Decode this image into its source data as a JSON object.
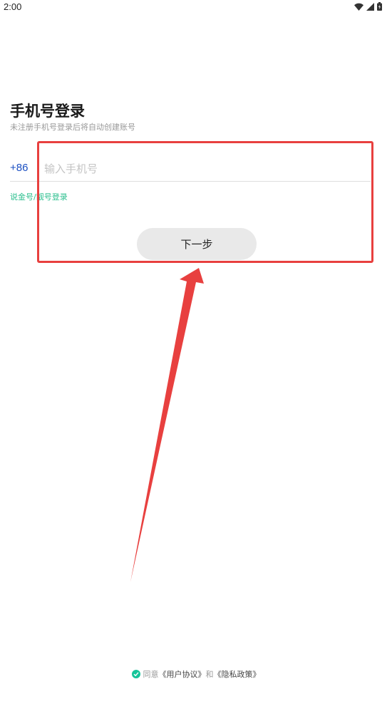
{
  "status_bar": {
    "time": "2:00",
    "icons": [
      "wifi-icon",
      "signal-icon",
      "battery-icon"
    ]
  },
  "login": {
    "title": "手机号登录",
    "subtitle": "未注册手机号登录后将自动创建账号",
    "country_code": "+86",
    "phone_placeholder": "输入手机号",
    "phone_value": "",
    "alt_login": "说金号/靓号登录",
    "next_button": "下一步"
  },
  "agreement": {
    "prefix": "同意",
    "user_agreement": "《用户协议》",
    "and": "和",
    "privacy_policy": "《隐私政策》",
    "checked": true
  },
  "colors": {
    "annotation_red": "#e8403f",
    "accent_blue": "#1b4fc2",
    "accent_green": "#2bbf8e",
    "check_green": "#16c59a"
  }
}
